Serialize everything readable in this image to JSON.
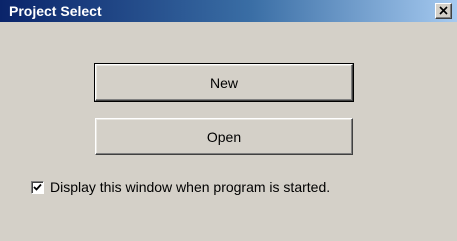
{
  "window": {
    "title": "Project Select",
    "close_icon": "close-icon",
    "title_bar_colors": [
      "#0a246a",
      "#a6caf0"
    ],
    "face_color": "#d4d0c8"
  },
  "buttons": {
    "new_label": "New",
    "open_label": "Open"
  },
  "startup_option": {
    "label": "Display this window when program is started.",
    "checked": true,
    "check_icon": "checkmark-icon"
  }
}
